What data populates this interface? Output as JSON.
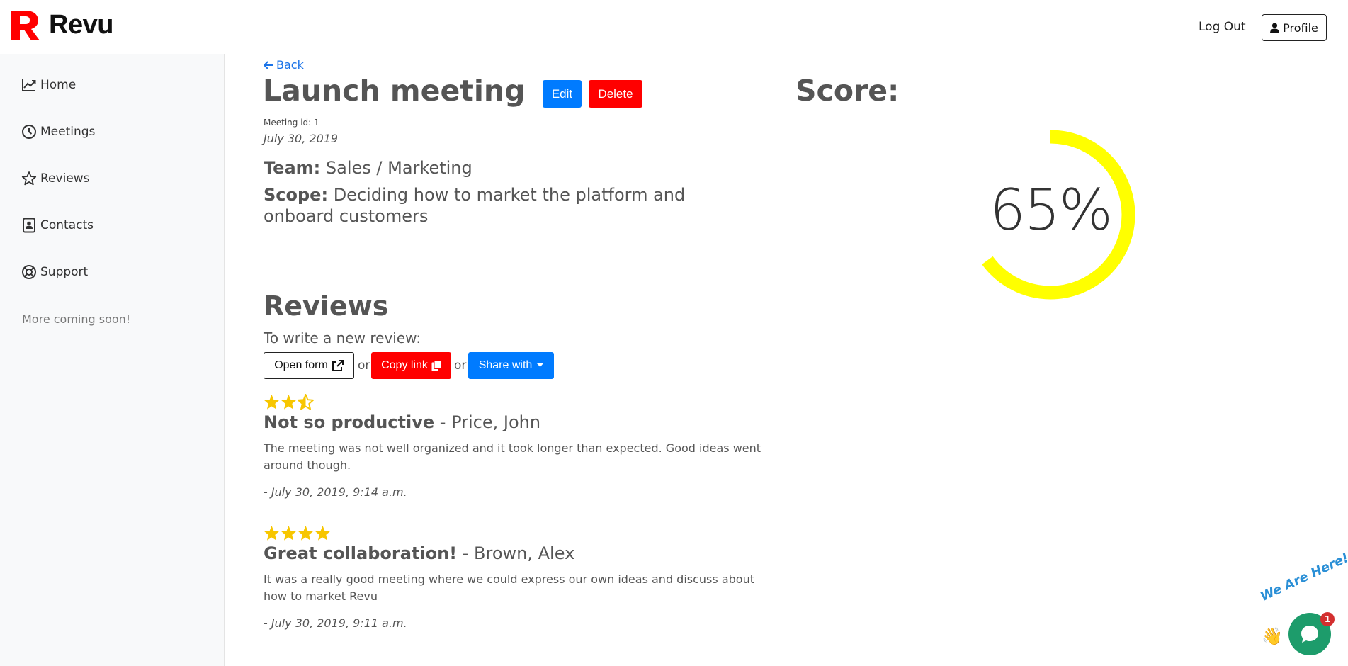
{
  "header": {
    "brand": "Revu",
    "logout_label": "Log Out",
    "profile_label": "Profile"
  },
  "sidebar": {
    "items": [
      {
        "label": "Home",
        "icon": "chart-line-icon"
      },
      {
        "label": "Meetings",
        "icon": "clock-icon"
      },
      {
        "label": "Reviews",
        "icon": "star-icon"
      },
      {
        "label": "Contacts",
        "icon": "contact-card-icon"
      },
      {
        "label": "Support",
        "icon": "life-ring-icon"
      }
    ],
    "note": "More coming soon!"
  },
  "meeting": {
    "back_label": "Back",
    "title": "Launch meeting",
    "edit_label": "Edit",
    "delete_label": "Delete",
    "id_text": "Meeting id: 1",
    "date": "July 30, 2019",
    "team_label": "Team:",
    "team_value": "Sales / Marketing",
    "scope_label": "Scope:",
    "scope_value": "Deciding how to market the platform and onboard customers"
  },
  "reviews": {
    "title": "Reviews",
    "write_label": "To write a new review:",
    "open_form_label": "Open form",
    "or_text": "or",
    "copy_link_label": "Copy link",
    "share_label": "Share with",
    "items": [
      {
        "rating": 2.5,
        "headline": "Not so productive",
        "author": "- Price, John",
        "body": "The meeting was not well organized and it took longer than expected. Good ideas went around though.",
        "time": "- July 30, 2019, 9:14 a.m."
      },
      {
        "rating": 4,
        "headline": "Great collaboration!",
        "author": "- Brown, Alex",
        "body": "It was a really good meeting where we could express our own ideas and discuss about how to market Revu",
        "time": "- July 30, 2019, 9:11 a.m."
      }
    ]
  },
  "score": {
    "label": "Score:",
    "value": 0.65,
    "display": "65%",
    "color": "#ffff00"
  },
  "chat": {
    "tagline": "We Are Here!",
    "badge_count": "1",
    "color": "#1d9c6b"
  },
  "colors": {
    "brand_red": "#ff0000",
    "primary_blue": "#007bff",
    "star_gold": "#f7c600"
  }
}
